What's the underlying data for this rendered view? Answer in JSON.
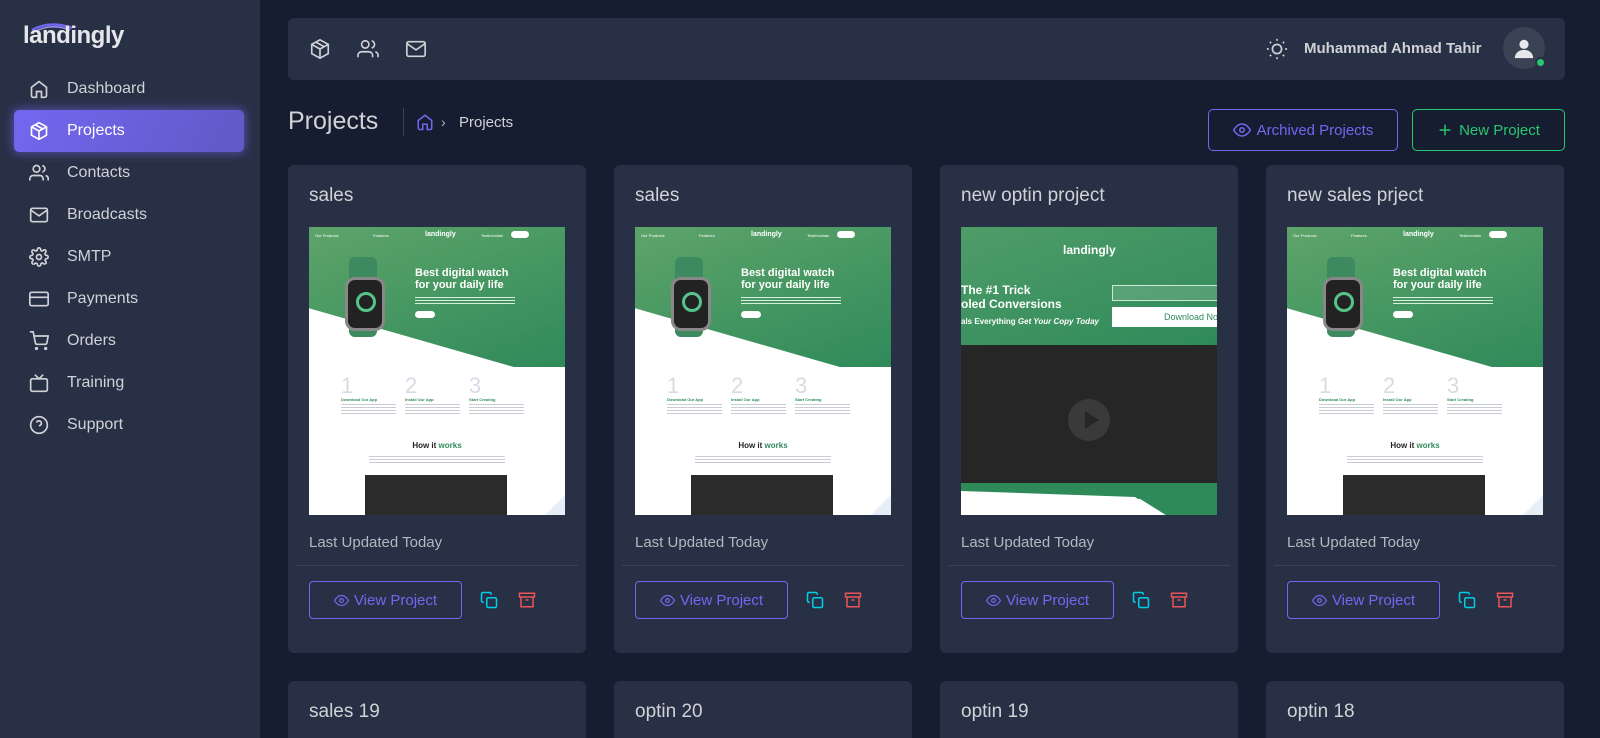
{
  "app": {
    "logo": "landingly"
  },
  "sidebar": {
    "items": [
      {
        "label": "Dashboard",
        "icon": "home-icon"
      },
      {
        "label": "Projects",
        "icon": "box-icon",
        "active": true
      },
      {
        "label": "Contacts",
        "icon": "users-icon"
      },
      {
        "label": "Broadcasts",
        "icon": "mail-icon"
      },
      {
        "label": "SMTP",
        "icon": "gear-icon"
      },
      {
        "label": "Payments",
        "icon": "credit-card-icon"
      },
      {
        "label": "Orders",
        "icon": "cart-icon"
      },
      {
        "label": "Training",
        "icon": "tv-icon"
      },
      {
        "label": "Support",
        "icon": "help-circle-icon"
      }
    ]
  },
  "topbar": {
    "shortcuts": [
      "box-icon",
      "users-icon",
      "mail-icon"
    ],
    "theme_icon": "sun-icon",
    "user_name": "Muhammad Ahmad Tahir",
    "status_color": "#28c76f"
  },
  "header": {
    "title": "Projects",
    "breadcrumb_current": "Projects",
    "archived_label": "Archived Projects",
    "new_label": "New Project"
  },
  "projects": [
    {
      "title": "sales",
      "updated": "Last Updated Today",
      "view_label": "View Project",
      "template": "sales"
    },
    {
      "title": "sales",
      "updated": "Last Updated Today",
      "view_label": "View Project",
      "template": "sales"
    },
    {
      "title": "new optin project",
      "updated": "Last Updated Today",
      "view_label": "View Project",
      "template": "optin"
    },
    {
      "title": "new sales prject",
      "updated": "Last Updated Today",
      "view_label": "View Project",
      "template": "sales"
    },
    {
      "title": "sales 19"
    },
    {
      "title": "optin 20"
    },
    {
      "title": "optin 19"
    },
    {
      "title": "optin 18"
    }
  ],
  "thumb_sales": {
    "nav": [
      "Our Products",
      "Features",
      "Testimonials"
    ],
    "nav_btn": "Help",
    "logo": "landingly",
    "headline_1": "Best digital watch",
    "headline_2": "for your daily life",
    "cta": "Buy Now",
    "steps": [
      {
        "num": "1",
        "label": "Download Our App"
      },
      {
        "num": "2",
        "label": "Install Our App"
      },
      {
        "num": "3",
        "label": "Start Creating"
      }
    ],
    "how_1": "How it",
    "how_2": "works"
  },
  "thumb_optin": {
    "logo": "landingly",
    "headline_1": "The #1 Trick",
    "headline_2": "oled Conversions",
    "subline_1": "als Everything",
    "subline_2": "Get Your Copy Today",
    "button": "Download No"
  },
  "colors": {
    "accent": "#7367f0",
    "success": "#28c76f",
    "info": "#00cfe8",
    "danger": "#ea5455"
  }
}
